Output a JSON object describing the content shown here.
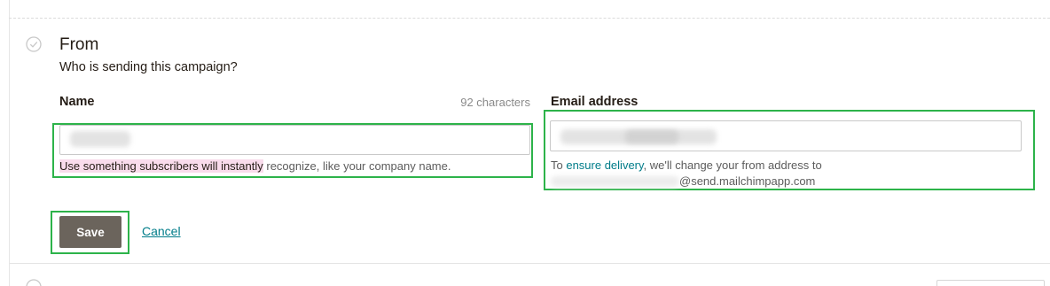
{
  "section": {
    "title": "From",
    "subtitle": "Who is sending this campaign?",
    "status_icon": "check-circle-icon"
  },
  "name_field": {
    "label": "Name",
    "char_count": "92 characters",
    "value": "",
    "hint_highlighted": "Use something subscribers will instantly",
    "hint_rest": " recognize, like your company name."
  },
  "email_field": {
    "label": "Email address",
    "value": "",
    "hint_prefix": "To ",
    "hint_link": "ensure delivery",
    "hint_suffix": ", we'll change your from address to",
    "address_suffix": "@send.mailchimpapp.com"
  },
  "actions": {
    "save_label": "Save",
    "cancel_label": "Cancel"
  },
  "colors": {
    "highlight_outline": "#2db34a",
    "save_button_bg": "#6b645c",
    "link": "#007c89",
    "hint_highlight": "#f9dcec"
  }
}
